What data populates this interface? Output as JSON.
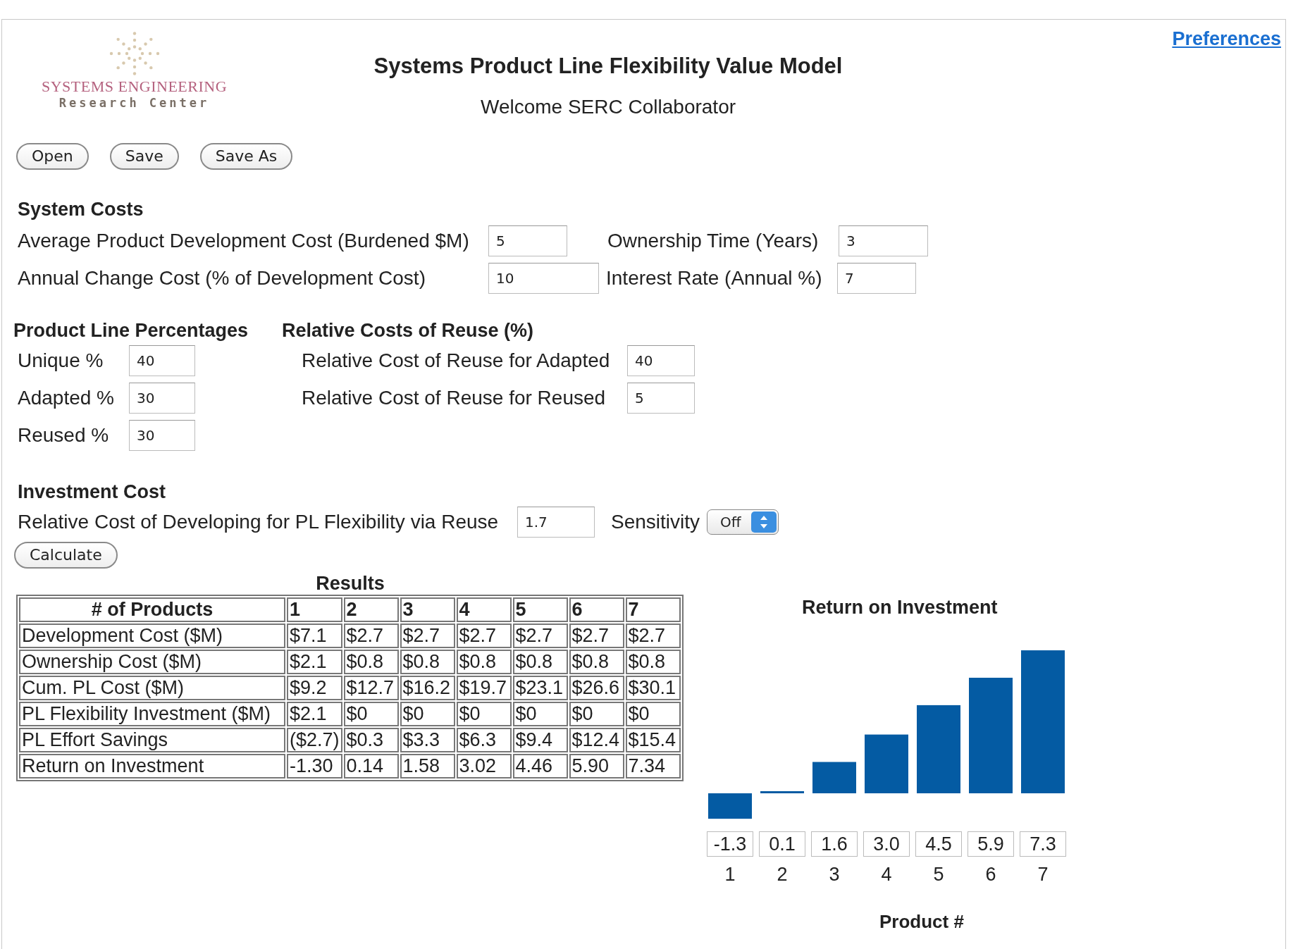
{
  "logo": {
    "name": "SYSTEMS ENGINEERING",
    "subtitle": "Research Center"
  },
  "header": {
    "title": "Systems Product Line Flexibility Value Model",
    "welcome": "Welcome SERC Collaborator"
  },
  "preferences_link": "Preferences",
  "file_buttons": [
    "Open",
    "Save",
    "Save As"
  ],
  "system_costs": {
    "heading": "System Costs",
    "fields": [
      {
        "label": "Average Product Development Cost (Burdened $M)",
        "value": "5"
      },
      {
        "label": "Ownership Time (Years)",
        "value": "3"
      },
      {
        "label": "Annual Change Cost (% of Development Cost)",
        "value": "10"
      },
      {
        "label": "Interest Rate (Annual %)",
        "value": "7"
      }
    ]
  },
  "product_line_percentages": {
    "heading": "Product Line Percentages",
    "fields": [
      {
        "label": "Unique %",
        "value": "40"
      },
      {
        "label": "Adapted %",
        "value": "30"
      },
      {
        "label": "Reused %",
        "value": "30"
      }
    ]
  },
  "relative_costs_of_reuse": {
    "heading": "Relative Costs of Reuse (%)",
    "fields": [
      {
        "label": "Relative Cost of Reuse for Adapted",
        "value": "40"
      },
      {
        "label": "Relative Cost of Reuse for Reused",
        "value": "5"
      }
    ]
  },
  "investment_cost": {
    "heading": "Investment Cost",
    "field": {
      "label": "Relative Cost of Developing for PL Flexibility via Reuse",
      "value": "1.7"
    },
    "sensitivity": {
      "label": "Sensitivity",
      "value": "Off"
    }
  },
  "calculate_button": "Calculate",
  "results": {
    "title": "Results",
    "columns": [
      "# of Products",
      "1",
      "2",
      "3",
      "4",
      "5",
      "6",
      "7"
    ],
    "rows": [
      [
        "Development Cost ($M)",
        "$7.1",
        "$2.7",
        "$2.7",
        "$2.7",
        "$2.7",
        "$2.7",
        "$2.7"
      ],
      [
        "Ownership Cost ($M)",
        "$2.1",
        "$0.8",
        "$0.8",
        "$0.8",
        "$0.8",
        "$0.8",
        "$0.8"
      ],
      [
        "Cum. PL Cost ($M)",
        "$9.2",
        "$12.7",
        "$16.2",
        "$19.7",
        "$23.1",
        "$26.6",
        "$30.1"
      ],
      [
        "PL Flexibility Investment ($M)",
        "$2.1",
        "$0",
        "$0",
        "$0",
        "$0",
        "$0",
        "$0"
      ],
      [
        "PL Effort Savings",
        "($2.7)",
        "$0.3",
        "$3.3",
        "$6.3",
        "$9.4",
        "$12.4",
        "$15.4"
      ],
      [
        "Return on Investment",
        "-1.30",
        "0.14",
        "1.58",
        "3.02",
        "4.46",
        "5.90",
        "7.34"
      ]
    ]
  },
  "roi_chart": {
    "chart_data": {
      "type": "bar",
      "title": "Return on Investment",
      "xlabel": "Product #",
      "categories": [
        "1",
        "2",
        "3",
        "4",
        "5",
        "6",
        "7"
      ],
      "values": [
        -1.3,
        0.1,
        1.6,
        3.0,
        4.5,
        5.9,
        7.3
      ],
      "value_labels": [
        "-1.3",
        "0.1",
        "1.6",
        "3.0",
        "4.5",
        "5.9",
        "7.3"
      ]
    }
  }
}
